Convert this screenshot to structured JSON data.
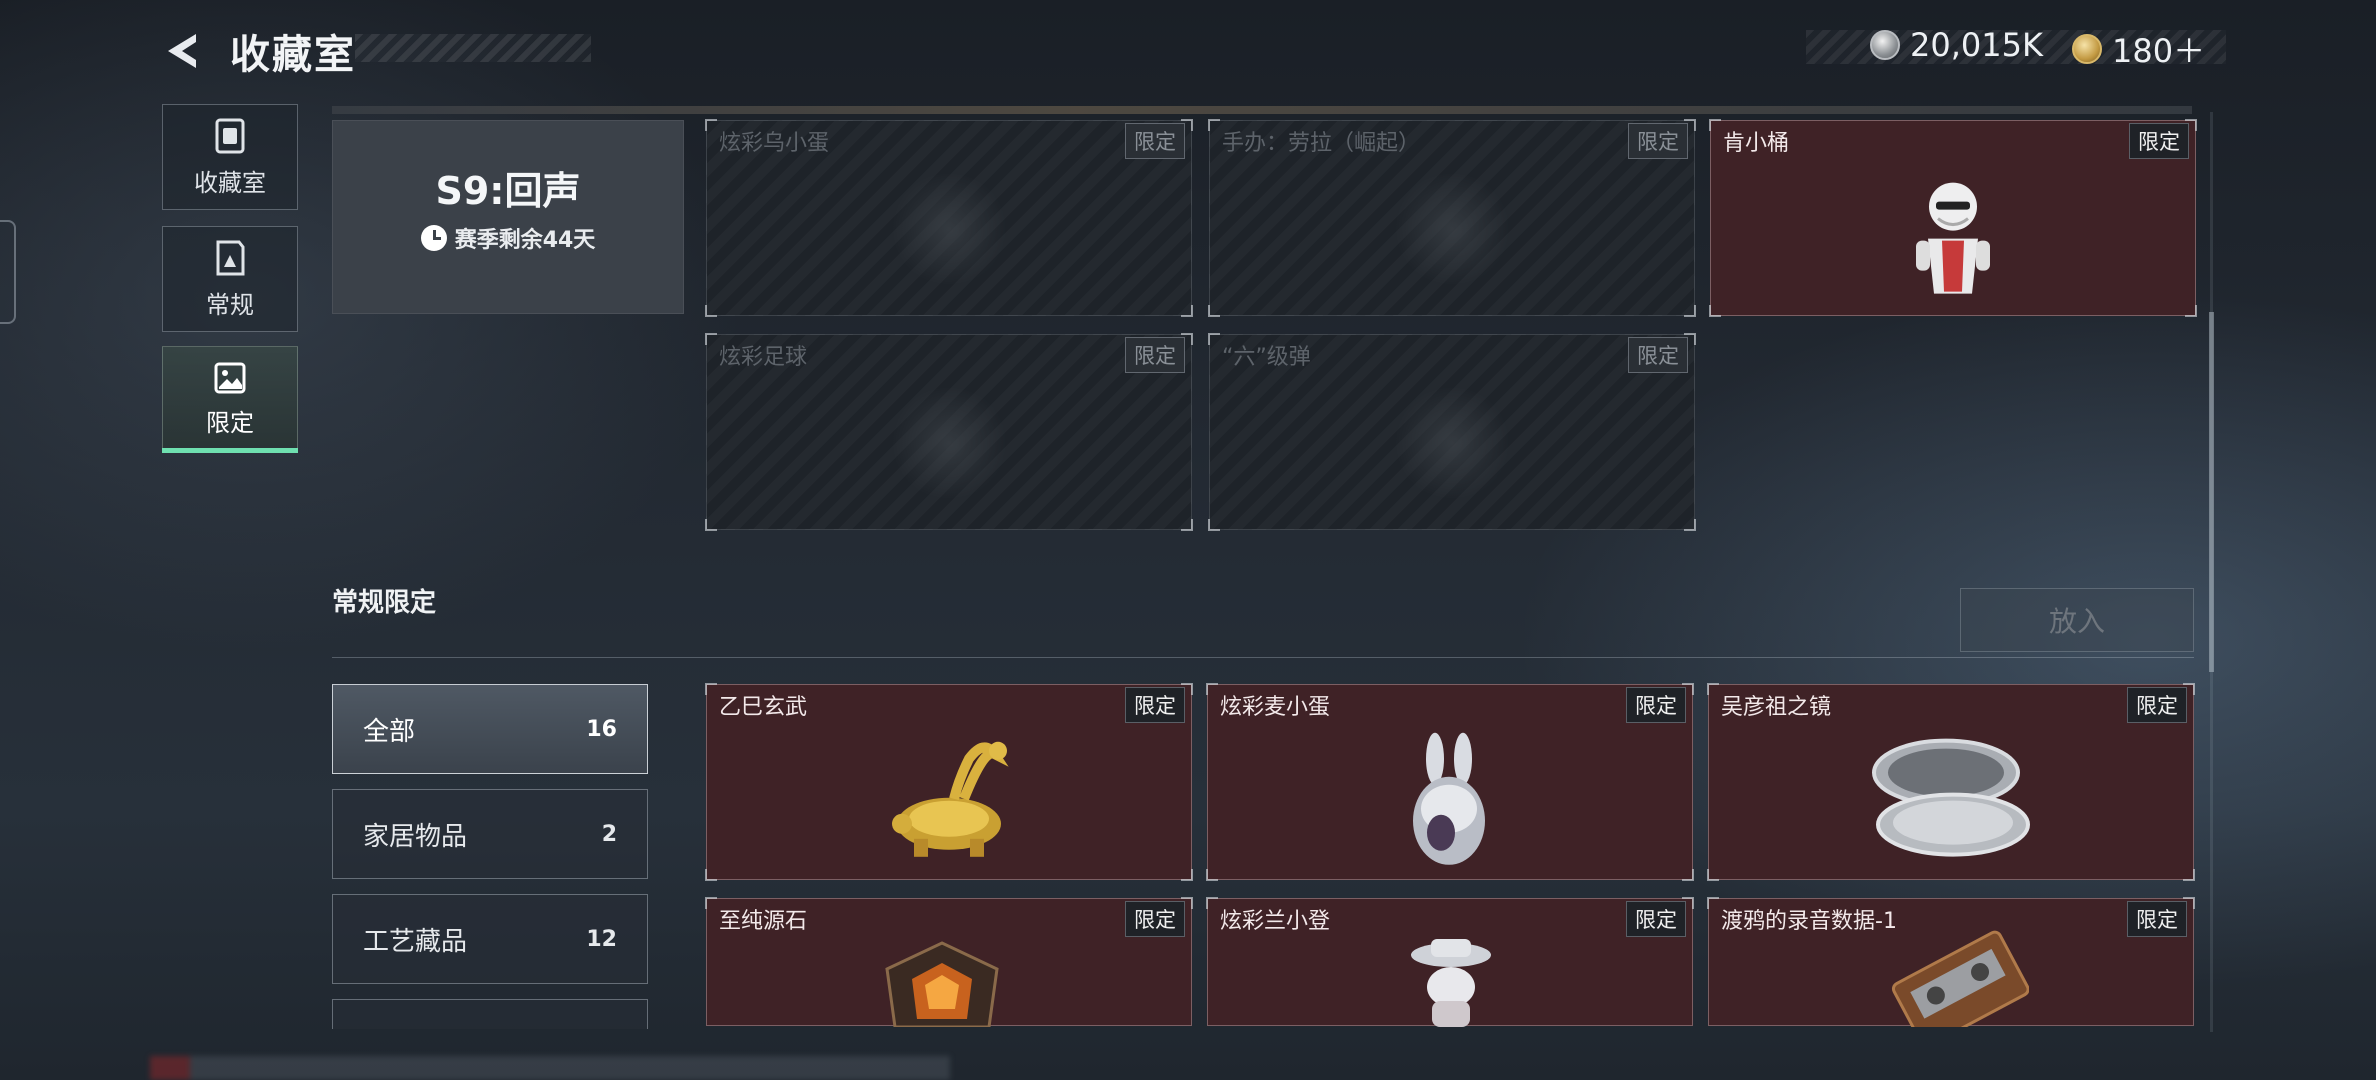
{
  "header": {
    "title": "收藏室",
    "currencies": [
      {
        "icon": "silver-coin-icon",
        "value": "20,015K"
      },
      {
        "icon": "gold-coin-icon",
        "value": "180＋"
      }
    ]
  },
  "sidebar": {
    "items": [
      {
        "label": "收藏室",
        "icon": "collection-room-icon"
      },
      {
        "label": "常规",
        "icon": "regular-book-icon"
      },
      {
        "label": "限定",
        "icon": "limited-image-icon",
        "active": true
      }
    ]
  },
  "season": {
    "title": "S9:回声",
    "remaining": "赛季剩余44天"
  },
  "season_items": [
    {
      "name": "炫彩乌小蛋",
      "badge": "限定",
      "owned": false
    },
    {
      "name": "手办：劳拉（崛起）",
      "badge": "限定",
      "owned": false
    },
    {
      "name": "肯小桶",
      "badge": "限定",
      "owned": true
    },
    {
      "name": "炫彩足球",
      "badge": "限定",
      "owned": false
    },
    {
      "name": "“六”级弹",
      "badge": "限定",
      "owned": false
    }
  ],
  "section": {
    "title": "常规限定",
    "put_button": "放入"
  },
  "filters": [
    {
      "label": "全部",
      "count": "16",
      "active": true
    },
    {
      "label": "家居物品",
      "count": "2"
    },
    {
      "label": "工艺藏品",
      "count": "12"
    }
  ],
  "regular_items": [
    {
      "name": "乙巳玄武",
      "badge": "限定"
    },
    {
      "name": "炫彩麦小蛋",
      "badge": "限定"
    },
    {
      "name": "吴彦祖之镜",
      "badge": "限定"
    },
    {
      "name": "至纯源石",
      "badge": "限定"
    },
    {
      "name": "炫彩兰小登",
      "badge": "限定"
    },
    {
      "name": "渡鸦的录音数据-1",
      "badge": "限定"
    }
  ],
  "colors": {
    "accent_green": "#6fe0b0",
    "owned_card": "#3f2226",
    "locked_card": "#1e2329"
  }
}
